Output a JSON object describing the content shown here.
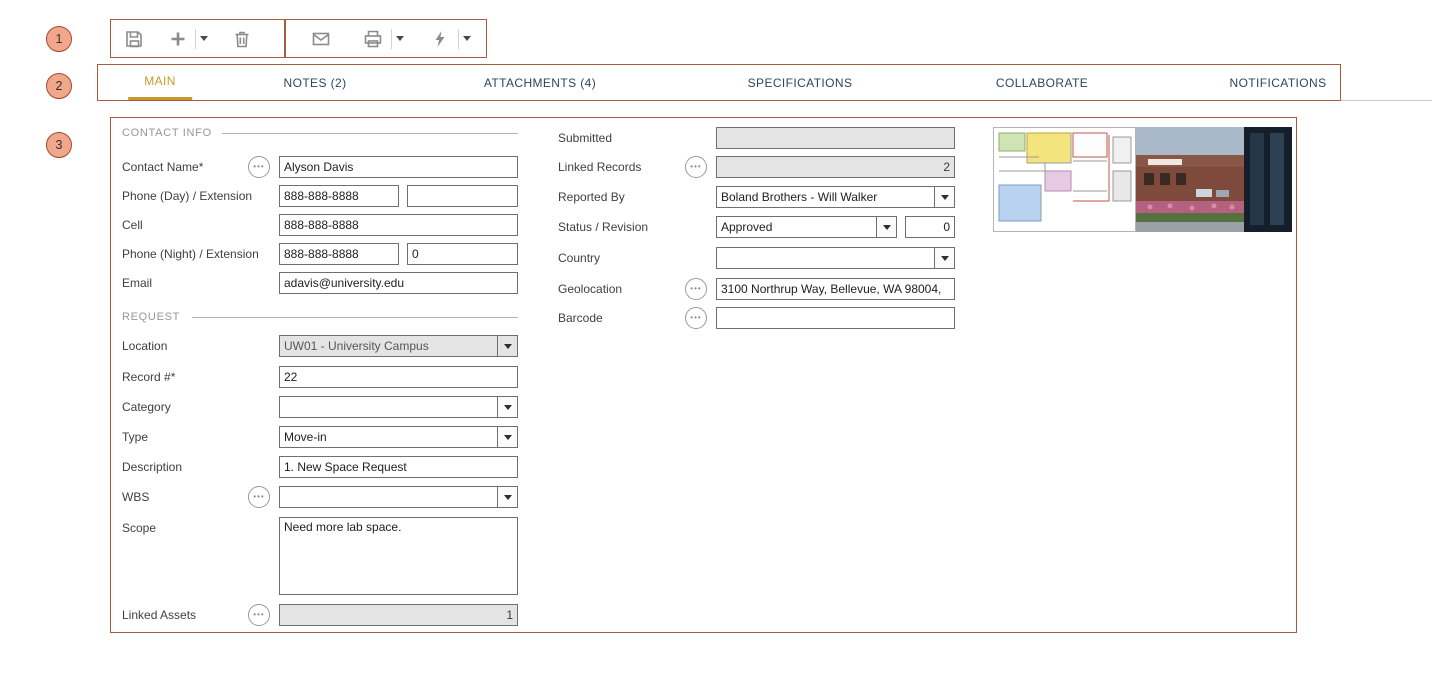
{
  "callouts": [
    "1",
    "2",
    "3"
  ],
  "toolbar": {
    "icons": [
      {
        "name": "save-icon",
        "glyph": "floppy-disk",
        "dropdown": false
      },
      {
        "name": "add-icon",
        "glyph": "plus",
        "dropdown": true
      },
      {
        "name": "delete-icon",
        "glyph": "trash",
        "dropdown": false
      },
      {
        "name": "email-icon",
        "glyph": "envelope",
        "dropdown": false
      },
      {
        "name": "print-icon",
        "glyph": "printer",
        "dropdown": true
      },
      {
        "name": "actions-icon",
        "glyph": "lightning-bolt",
        "dropdown": true
      }
    ]
  },
  "tabs": [
    {
      "label": "MAIN",
      "active": true
    },
    {
      "label": "NOTES (2)",
      "active": false
    },
    {
      "label": "ATTACHMENTS (4)",
      "active": false
    },
    {
      "label": "SPECIFICATIONS",
      "active": false
    },
    {
      "label": "COLLABORATE",
      "active": false
    },
    {
      "label": "NOTIFICATIONS",
      "active": false
    }
  ],
  "sections": {
    "contact_info": "CONTACT INFO",
    "request": "REQUEST"
  },
  "fields": {
    "contact_name": {
      "label": "Contact Name*",
      "value": "Alyson Davis"
    },
    "phone_day": {
      "label": "Phone (Day) / Extension",
      "value": "888-888-8888",
      "extension": ""
    },
    "cell": {
      "label": "Cell",
      "value": "888-888-8888"
    },
    "phone_night": {
      "label": "Phone (Night) / Extension",
      "value": "888-888-8888",
      "extension": "0"
    },
    "email": {
      "label": "Email",
      "value": "adavis@university.edu"
    },
    "location": {
      "label": "Location",
      "value": "UW01 - University Campus"
    },
    "record_number": {
      "label": "Record #*",
      "value": "22"
    },
    "category": {
      "label": "Category",
      "value": ""
    },
    "type": {
      "label": "Type",
      "value": "Move-in"
    },
    "description": {
      "label": "Description",
      "value": "1. New Space Request"
    },
    "wbs": {
      "label": "WBS",
      "value": ""
    },
    "scope": {
      "label": "Scope",
      "value": "Need more lab space."
    },
    "linked_assets": {
      "label": "Linked Assets",
      "value": "1"
    },
    "submitted": {
      "label": "Submitted",
      "value": ""
    },
    "linked_records": {
      "label": "Linked Records",
      "value": "2"
    },
    "reported_by": {
      "label": "Reported By",
      "value": "Boland Brothers - Will Walker"
    },
    "status_revision": {
      "label": "Status / Revision",
      "value": "Approved",
      "revision": "0"
    },
    "country": {
      "label": "Country",
      "value": ""
    },
    "geolocation": {
      "label": "Geolocation",
      "value": "3100 Northrup Way, Bellevue, WA 98004,"
    },
    "barcode": {
      "label": "Barcode",
      "value": ""
    }
  },
  "images": [
    {
      "name": "floor-plan-thumbnail"
    },
    {
      "name": "building-photo-thumbnail"
    }
  ],
  "colors": {
    "accent": "#c9992f",
    "annotation": "#a85b41",
    "callout_fill": "#f0a78c",
    "tab_text": "#31455a",
    "disabled_bg": "#e4e4e4"
  }
}
